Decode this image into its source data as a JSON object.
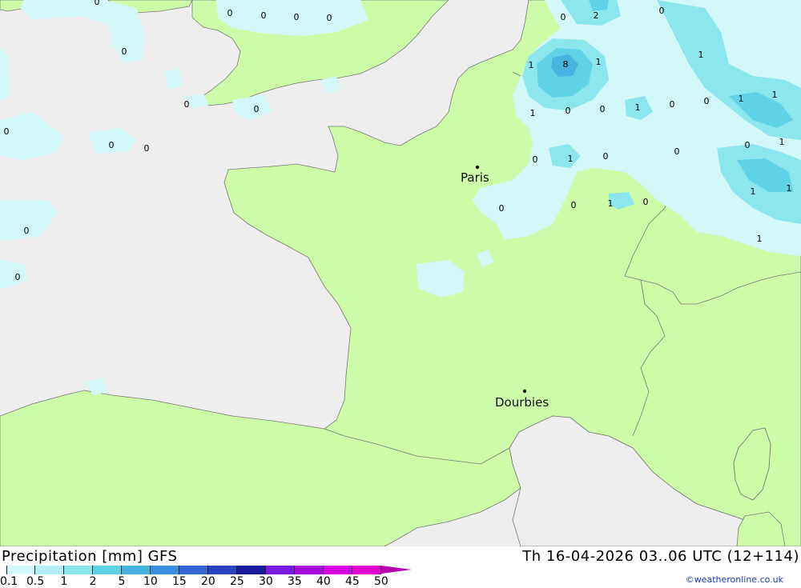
{
  "map": {
    "cities": [
      {
        "name": "Paris"
      },
      {
        "name": "Dourbies"
      }
    ],
    "values": [
      "0",
      "0",
      "0",
      "0",
      "0",
      "0",
      "0",
      "0",
      "0",
      "0",
      "0",
      "0",
      "0",
      "0",
      "2",
      "0",
      "1",
      "8",
      "1",
      "1",
      "1",
      "0",
      "0",
      "1",
      "0",
      "0",
      "1",
      "1",
      "1",
      "0",
      "1",
      "0",
      "1",
      "0",
      "0",
      "1",
      "0",
      "0",
      "0",
      "1",
      "1",
      "0"
    ]
  },
  "footer": {
    "title": "Precipitation [mm] GFS",
    "time": "Th 16-04-2026 03..06 UTC (12+114)",
    "credit": "©weatheronline.co.uk"
  },
  "legend": {
    "labels": [
      "0.1",
      "0.5",
      "1",
      "2",
      "5",
      "10",
      "15",
      "20",
      "25",
      "30",
      "35",
      "40",
      "45",
      "50"
    ],
    "colors": [
      "#d2f8fa",
      "#b0f0f4",
      "#8ce6ee",
      "#60d2e6",
      "#46b4de",
      "#3c8ee0",
      "#3466d4",
      "#2a42c0",
      "#1a1a9c",
      "#7a1ae0",
      "#a80ae0",
      "#d600e8",
      "#e200d0",
      "#b800a8"
    ],
    "colors_meaning": {
      "land": "#cdfca8",
      "sea": "#eeeeee",
      "border": "#777777"
    }
  }
}
